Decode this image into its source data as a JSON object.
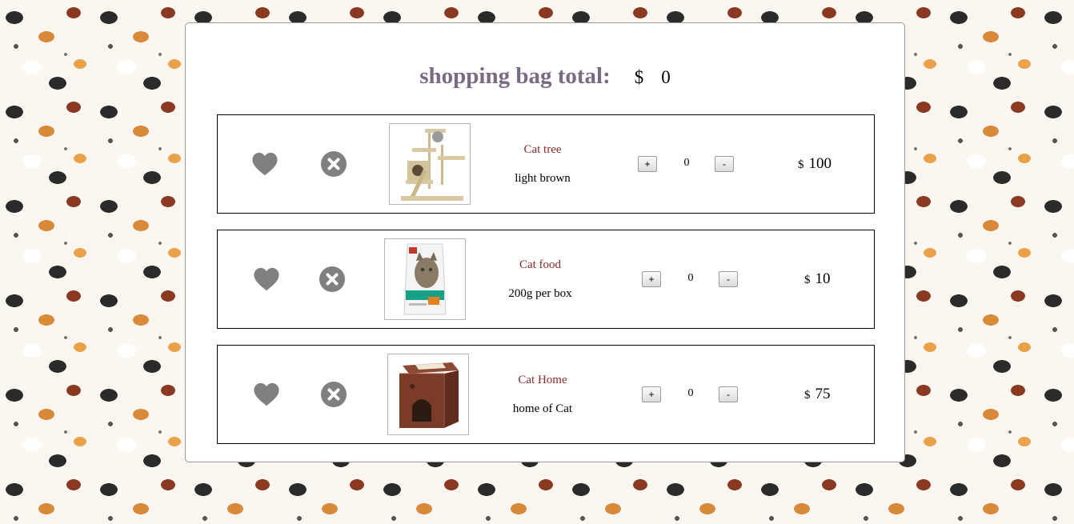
{
  "header": {
    "total_label": "shopping bag total:",
    "currency": "$",
    "total_value": "0"
  },
  "items": [
    {
      "name": "Cat tree",
      "description": "light brown",
      "quantity": "0",
      "plus": "+",
      "minus": "-",
      "currency": "$",
      "price": "100"
    },
    {
      "name": "Cat food",
      "description": "200g per box",
      "quantity": "0",
      "plus": "+",
      "minus": "-",
      "currency": "$",
      "price": "10"
    },
    {
      "name": "Cat Home",
      "description": "home of Cat",
      "quantity": "0",
      "plus": "+",
      "minus": "-",
      "currency": "$",
      "price": "75"
    }
  ],
  "colors": {
    "total_label": "#7a6a84",
    "item_name": "#8b2a2a",
    "icon_gray": "#808080"
  }
}
